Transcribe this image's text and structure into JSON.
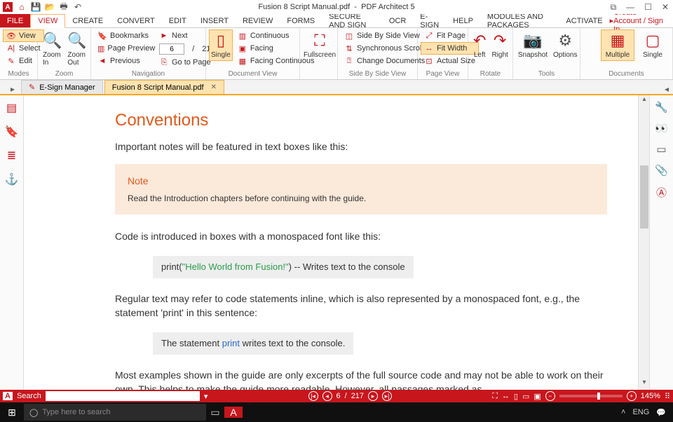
{
  "colors": {
    "accent": "#c8161d",
    "highlight": "#ffe3b0",
    "doc_heading": "#e05a1d"
  },
  "title": {
    "doc": "Fusion 8 Script Manual.pdf",
    "sep": "-",
    "app": "PDF Architect 5"
  },
  "account_link": "Create Account / Sign In",
  "menutabs": [
    "FILE",
    "VIEW",
    "CREATE",
    "CONVERT",
    "EDIT",
    "INSERT",
    "REVIEW",
    "FORMS",
    "SECURE AND SIGN",
    "OCR",
    "E-SIGN",
    "HELP",
    "MODULES AND PACKAGES",
    "ACTIVATE"
  ],
  "menutab_active": "VIEW",
  "ribbon": {
    "modes": {
      "label": "Modes",
      "view": "View",
      "select": "Select",
      "edit": "Edit"
    },
    "zoom": {
      "label": "Zoom",
      "in": "Zoom In",
      "out": "Zoom Out"
    },
    "nav": {
      "label": "Navigation",
      "bookmarks": "Bookmarks",
      "pagepreview": "Page Preview",
      "previous": "Previous",
      "next": "Next",
      "gotopage": "Go to Page",
      "page_current": "6",
      "page_sep": "/",
      "page_total": "217"
    },
    "docview": {
      "label": "Document View",
      "single": "Single",
      "continuous": "Continuous",
      "facing": "Facing",
      "facingcont": "Facing Continuous"
    },
    "fullscreen": "Fullscreen",
    "sbs": {
      "label": "Side By Side View",
      "sbsview": "Side By Side View",
      "sync": "Synchronous Scrolling",
      "change": "Change Documents"
    },
    "pageview": {
      "label": "Page View",
      "fitpage": "Fit Page",
      "fitwidth": "Fit Width",
      "actual": "Actual Size"
    },
    "rotate": {
      "label": "Rotate",
      "left": "Left",
      "right": "Right"
    },
    "tools": {
      "label": "Tools",
      "snapshot": "Snapshot",
      "options": "Options"
    },
    "documents": {
      "label": "Documents",
      "multiple": "Multiple",
      "single": "Single"
    }
  },
  "doctabs": {
    "esign": "E-Sign Manager",
    "doc": "Fusion 8 Script Manual.pdf"
  },
  "page": {
    "h1": "Conventions",
    "p1": "Important notes will be featured in text boxes like this:",
    "note_title": "Note",
    "note_body": "Read the Introduction chapters before continuing with the guide.",
    "p2": "Code is introduced in boxes with a monospaced font like this:",
    "code1_a": "print(",
    "code1_b": "\"Hello World from Fusion!\"",
    "code1_c": ")   -- Writes text to the console",
    "p3": "Regular text may refer to code statements inline, which is also represented by a monospaced font, e.g., the statement 'print' in this sentence:",
    "code2_a": "The statement ",
    "code2_b": "print",
    "code2_c": " writes text to the console.",
    "p4": "Most examples shown in the guide are only excerpts of the full source code and may not be able to work on their own. This helps to make the guide more readable. However, all passages marked as"
  },
  "statusbar": {
    "search_label": "Search",
    "page_current": "6",
    "page_sep": "/",
    "page_total": "217",
    "zoom": "145%"
  },
  "taskbar": {
    "search_placeholder": "Type here to search",
    "lang": "ENG"
  }
}
